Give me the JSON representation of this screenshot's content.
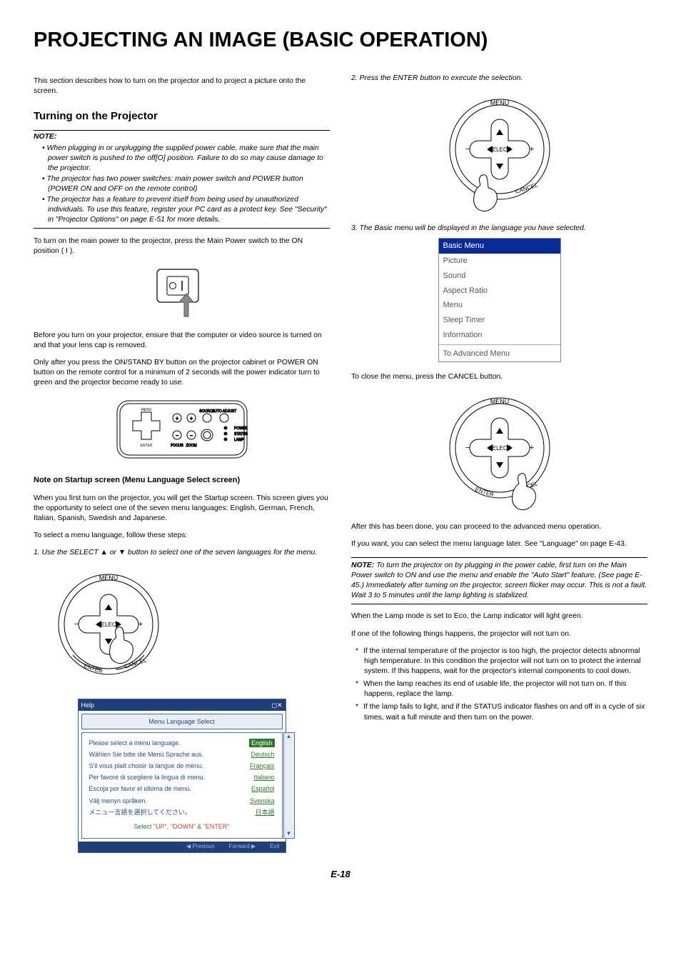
{
  "title": "PROJECTING AN IMAGE (BASIC OPERATION)",
  "intro": "This section describes how to turn on the projector and to project a picture onto the screen.",
  "left": {
    "h_turning": "Turning on the Projector",
    "note_label": "NOTE:",
    "note_items": [
      "When plugging in or unplugging the supplied power cable, make sure that the main power switch is pushed to the off[O] position. Failure to do so may cause damage to the projector.",
      "The projector has two power switches: main power switch and POWER button (POWER ON and OFF on the remote control)",
      "The projector has a feature to prevent itself from being used by unauthorized individuals. To use this feature, register your PC card as a protect key. See \"Security\" in \"Projector Options\" on page E-51 for more details."
    ],
    "p_mainpower": "To turn on the main power to the projector, press the Main Power switch to the ON position ( I ).",
    "p_before": "Before you turn on your projector, ensure that the computer or video source is turned on and that your lens cap is removed.",
    "p_only": "Only after you press the ON/STAND BY button on the projector cabinet or POWER ON button on the remote control for a minimum of 2 seconds will the power indicator turn to green and the projector become ready to use.",
    "h_startup": "Note on Startup screen (Menu Language Select screen)",
    "p_startup1": "When you first turn on the projector, you will get the Startup screen. This screen gives you the opportunity to select one of the seven menu languages: English, German, French, Italian, Spanish, Swedish and Japanese.",
    "p_startup2": "To select a menu language, follow these steps:",
    "step1": "1. Use the SELECT ▲ or ▼ button to select one of the seven languages for the menu.",
    "dpad": {
      "menu": "MENU",
      "select": "SELECT",
      "enter": "ENTER",
      "cancel": "CANCEL",
      "minus": "−",
      "plus": "+"
    },
    "lang_window": {
      "bar_left": "Help",
      "bar_right": "◻✕",
      "header": "Menu Language Select",
      "rows": [
        {
          "txt": "Please select a menu language.",
          "opt": "English",
          "sel": true
        },
        {
          "txt": "Wählen Sie bitte die Menü Sprache aus.",
          "opt": "Deutsch"
        },
        {
          "txt": "S'il vous plaît choisir la langue de menu.",
          "opt": "Français"
        },
        {
          "txt": "Per favore di scegliere la lingua di menu.",
          "opt": "Italiano"
        },
        {
          "txt": "Escoja por favor el idioma de menú.",
          "opt": "Español"
        },
        {
          "txt": "Välj menyn språken.",
          "opt": "Svenska"
        },
        {
          "txt": "メニュー言語を選択してください。",
          "opt": "日本語"
        }
      ],
      "footer_pre": "Select ",
      "footer_up": "\"UP\"",
      "footer_sep1": ", ",
      "footer_down": "\"DOWN\"",
      "footer_sep2": " & ",
      "footer_enter": "\"ENTER\"",
      "bottom_prev": "◀ Previous",
      "bottom_next": "Forward ▶",
      "bottom_exit": "Exit"
    }
  },
  "right": {
    "step2": "2. Press the ENTER button to execute the selection.",
    "step3": "3. The Basic menu will be displayed in the language you have selected.",
    "basic_menu": {
      "title": "Basic Menu",
      "items": [
        "Picture",
        "Sound",
        "Aspect Ratio",
        "Menu",
        "Sleep Timer",
        "Information",
        "To Advanced Menu"
      ]
    },
    "p_close": "To close the menu, press the CANCEL button.",
    "p_after": "After this has been done, you can proceed to the advanced menu operation.",
    "p_lang_later": "If you want, you can select the menu language later. See \"Language\" on page E-43.",
    "note2_label": "NOTE:",
    "note2": " To turn the projector on by plugging in the power cable, first turn on the Main Power switch to ON and use the menu and enable the \"Auto Start\" feature. (See page E-45.) Immediately after turning on the projector, screen flicker may occur. This is not a fault. Wait 3 to 5 minutes until the lamp lighting is stabilized.",
    "p_eco": "When the Lamp mode is set to Eco, the Lamp indicator will light green.",
    "p_noton": "If one of the following things happens, the projector will not turn on.",
    "bullets": [
      "If the internal temperature of the projector is too high, the projector detects abnormal high temperature. In this condition the projector will not turn on to protect the internal system. If this happens, wait for the projector's internal components to cool down.",
      "When the lamp reaches its end of usable life, the projector will not turn on. If this happens, replace the lamp.",
      "If the lamp fails to light, and if the STATUS indicator flashes on and off in a cycle of six times, wait a full minute and then turn on the power."
    ]
  },
  "page_num": "E-18"
}
